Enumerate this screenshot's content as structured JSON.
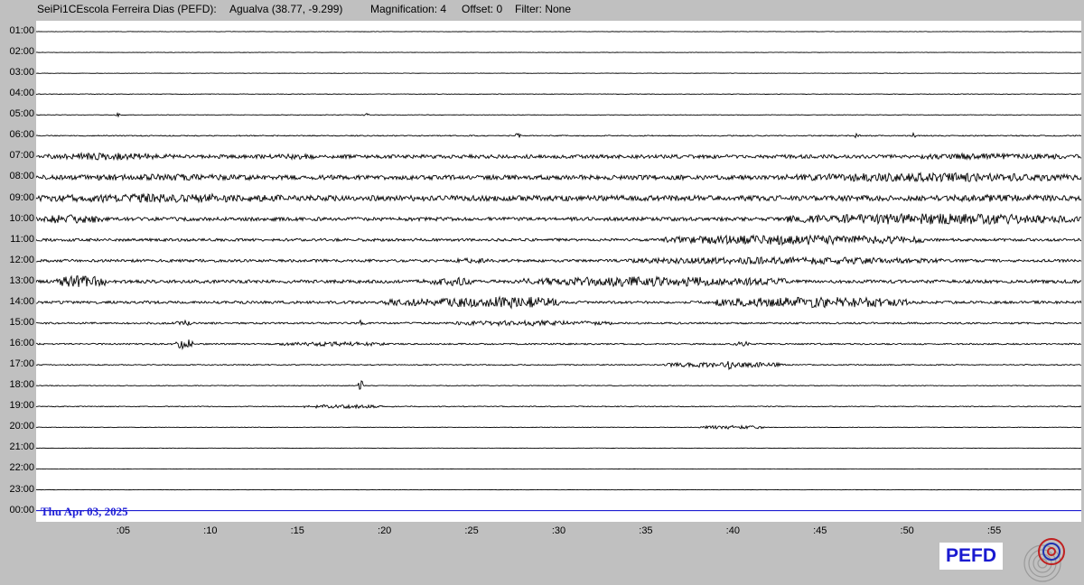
{
  "header": {
    "station": "SeiPi1CEscola Ferreira Dias (PEFD):",
    "location": "Agualva (38.77, -9.299)",
    "magnification": "Magnification: 4",
    "offset": "Offset: 0",
    "filter": "Filter: None"
  },
  "date_label": "Thu Apr 03, 2025",
  "logo": {
    "text": "PEFD",
    "color": "#1a1ad0"
  },
  "colors": {
    "trace": "#000000",
    "current_line": "#0000cc",
    "date_text": "#1f1fd6",
    "background": "#c0c0c0",
    "plot": "#ffffff"
  },
  "chart_data": {
    "type": "line",
    "subtype": "helicorder",
    "y_tick_labels": [
      "01:00",
      "02:00",
      "03:00",
      "04:00",
      "05:00",
      "06:00",
      "07:00",
      "08:00",
      "09:00",
      "10:00",
      "11:00",
      "12:00",
      "13:00",
      "14:00",
      "15:00",
      "16:00",
      "17:00",
      "18:00",
      "19:00",
      "20:00",
      "21:00",
      "22:00",
      "23:00",
      "00:00"
    ],
    "x_tick_labels": [
      ":05",
      ":10",
      ":15",
      ":20",
      ":25",
      ":30",
      ":35",
      ":40",
      ":45",
      ":50",
      ":55"
    ],
    "x_ticks_minutes": [
      5,
      10,
      15,
      20,
      25,
      30,
      35,
      40,
      45,
      50,
      55
    ],
    "xlim": [
      0,
      60
    ],
    "rows": [
      {
        "label": "01:00",
        "base": 0.2,
        "bursts": []
      },
      {
        "label": "02:00",
        "base": 0.2,
        "bursts": []
      },
      {
        "label": "03:00",
        "base": 0.2,
        "bursts": []
      },
      {
        "label": "04:00",
        "base": 0.3,
        "bursts": []
      },
      {
        "label": "05:00",
        "base": 0.3,
        "bursts": [
          [
            4.5,
            0.3,
            2
          ],
          [
            18.8,
            0.3,
            2
          ]
        ]
      },
      {
        "label": "06:00",
        "base": 0.6,
        "bursts": [
          [
            27.5,
            0.3,
            3
          ],
          [
            47,
            0.3,
            3
          ],
          [
            50.3,
            0.2,
            4
          ]
        ]
      },
      {
        "label": "07:00",
        "base": 2,
        "bursts": [
          [
            0,
            8,
            4
          ],
          [
            13,
            4,
            3
          ],
          [
            50,
            10,
            3.5
          ]
        ]
      },
      {
        "label": "08:00",
        "base": 2.5,
        "bursts": [
          [
            0,
            15,
            3.5
          ],
          [
            43,
            17,
            5
          ]
        ]
      },
      {
        "label": "09:00",
        "base": 3,
        "bursts": [
          [
            0,
            15,
            5
          ],
          [
            50,
            10,
            4
          ]
        ]
      },
      {
        "label": "10:00",
        "base": 2,
        "bursts": [
          [
            0,
            4,
            5
          ],
          [
            43,
            17,
            6
          ]
        ]
      },
      {
        "label": "11:00",
        "base": 1.5,
        "bursts": [
          [
            36,
            15,
            5.5
          ]
        ]
      },
      {
        "label": "12:00",
        "base": 1.5,
        "bursts": [
          [
            24,
            2,
            3
          ],
          [
            34,
            18,
            4
          ]
        ]
      },
      {
        "label": "13:00",
        "base": 1.8,
        "bursts": [
          [
            1,
            3,
            7
          ],
          [
            22,
            3,
            5
          ],
          [
            28,
            15,
            5.5
          ]
        ]
      },
      {
        "label": "14:00",
        "base": 1.5,
        "bursts": [
          [
            20,
            10,
            5
          ],
          [
            25,
            5,
            6.5
          ],
          [
            39,
            11,
            6
          ]
        ]
      },
      {
        "label": "15:00",
        "base": 1,
        "bursts": [
          [
            24,
            9,
            3
          ],
          [
            8,
            1,
            3
          ],
          [
            18.5,
            0.5,
            4
          ]
        ]
      },
      {
        "label": "16:00",
        "base": 0.8,
        "bursts": [
          [
            8,
            1,
            6
          ],
          [
            14,
            6,
            2.5
          ],
          [
            40,
            1,
            3
          ]
        ]
      },
      {
        "label": "17:00",
        "base": 0.6,
        "bursts": [
          [
            36,
            7,
            3
          ],
          [
            39.5,
            0.5,
            5
          ]
        ]
      },
      {
        "label": "18:00",
        "base": 0.4,
        "bursts": [
          [
            18.5,
            0.3,
            6
          ]
        ]
      },
      {
        "label": "19:00",
        "base": 0.5,
        "bursts": [
          [
            15,
            5,
            2
          ]
        ]
      },
      {
        "label": "20:00",
        "base": 0.3,
        "bursts": [
          [
            38,
            4,
            2
          ]
        ]
      },
      {
        "label": "21:00",
        "base": 0.25,
        "bursts": []
      },
      {
        "label": "22:00",
        "base": 0.2,
        "bursts": []
      },
      {
        "label": "23:00",
        "base": 0.2,
        "bursts": []
      },
      {
        "label": "00:00",
        "base": 0,
        "bursts": [],
        "current": true
      }
    ]
  }
}
